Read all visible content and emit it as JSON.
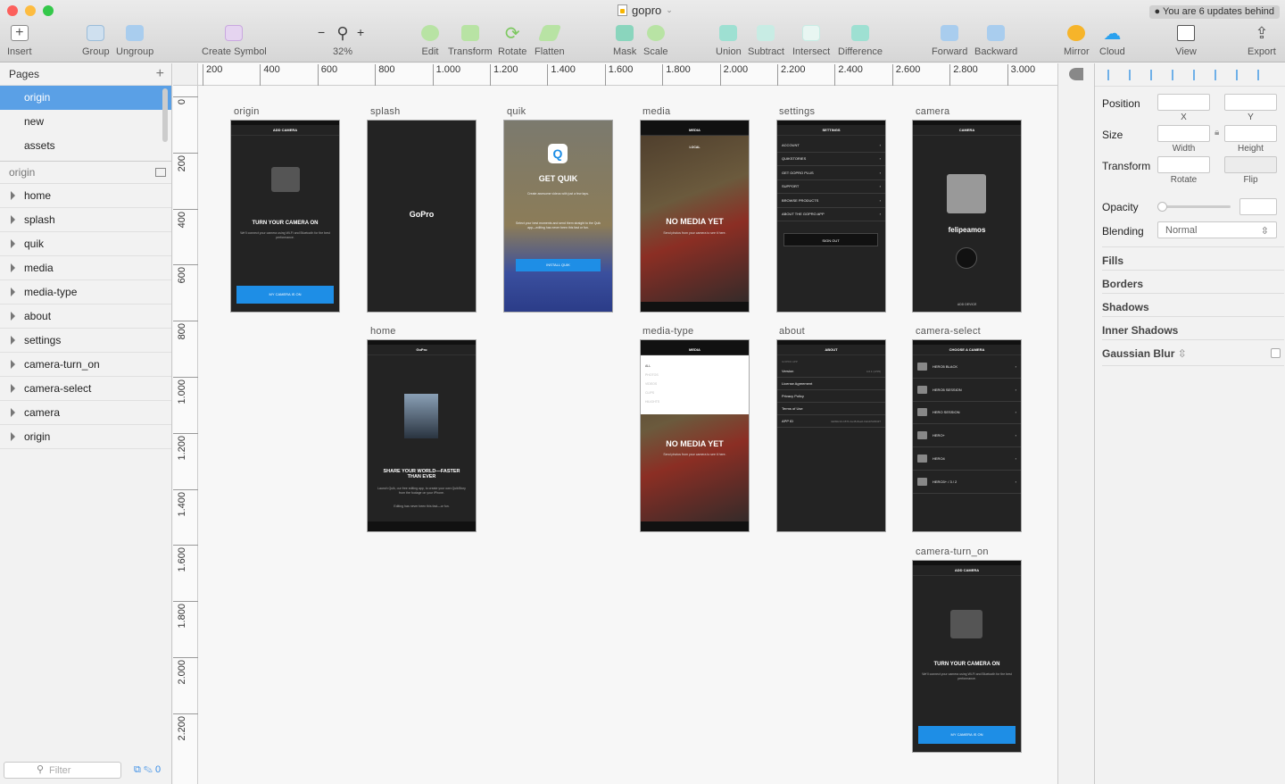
{
  "window": {
    "title": "gopro",
    "update_notice": "You are 6 updates behind"
  },
  "toolbar": {
    "insert": "Insert",
    "group": "Group",
    "ungroup": "Ungroup",
    "create_symbol": "Create Symbol",
    "zoom": "32%",
    "zoom_out": "−",
    "zoom_in": "+",
    "edit": "Edit",
    "transform": "Transform",
    "rotate": "Rotate",
    "flatten": "Flatten",
    "mask": "Mask",
    "scale": "Scale",
    "union": "Union",
    "subtract": "Subtract",
    "intersect": "Intersect",
    "difference": "Difference",
    "forward": "Forward",
    "backward": "Backward",
    "mirror": "Mirror",
    "cloud": "Cloud",
    "view": "View",
    "export": "Export"
  },
  "pages": {
    "header": "Pages",
    "add": "+",
    "items": [
      "origin",
      "new",
      "assets"
    ]
  },
  "layers": {
    "header": "origin",
    "items": [
      "home",
      "splash",
      "quik",
      "media",
      "media-type",
      "about",
      "settings",
      "camera-turn_on",
      "camera-select",
      "camera",
      "origin"
    ]
  },
  "filter": {
    "placeholder": "Filter",
    "count": "0"
  },
  "ruler": {
    "top": [
      "200",
      "400",
      "600",
      "800",
      "1.000",
      "1.200",
      "1.400",
      "1.600",
      "1.800",
      "2.000",
      "2.200",
      "2.400",
      "2.600",
      "2.800",
      "3.000"
    ],
    "left": [
      "0",
      "200",
      "400",
      "600",
      "800",
      "1.000",
      "1.200",
      "1.400",
      "1.600",
      "1.800",
      "2.000",
      "2.200"
    ]
  },
  "artboards": {
    "origin": {
      "label": "origin",
      "header": "ADD CAMERA",
      "title": "TURN YOUR CAMERA ON",
      "body": "We'll connect your camera using Wi-Fi and Bluetooth for the best performance.",
      "button": "MY CAMERA IS ON"
    },
    "splash": {
      "label": "splash",
      "logo": "GoPro"
    },
    "quik": {
      "label": "quik",
      "title": "GET QUIK",
      "body": "Create awesome videos with just a few taps.",
      "body2": "Select your best moments and send them straight to the Quik app—editing has never been this fast or fun.",
      "button": "INSTALL QUIK"
    },
    "media": {
      "label": "media",
      "header": "MEDIA",
      "tab": "LOCAL",
      "title": "NO MEDIA YET",
      "body": "Send photos from your camera to see it here."
    },
    "settings": {
      "label": "settings",
      "header": "SETTINGS",
      "rows": [
        "ACCOUNT",
        "QUIKSTORIES",
        "GET GOPRO PLUS",
        "SUPPORT",
        "BROWSE PRODUCTS",
        "ABOUT THE GOPRO APP"
      ],
      "button": "SIGN OUT"
    },
    "camera": {
      "label": "camera",
      "header": "CAMERA",
      "name": "felipeamos",
      "footer": "ADD DEVICE"
    },
    "home": {
      "label": "home",
      "logo": "GoPro",
      "title": "SHARE YOUR WORLD—FASTER THAN EVER",
      "body": "Launch Quik, our free editing app, to create your own QuikStory from the footage on your iPhone.",
      "body2": "Editing has never been this fast—or fun."
    },
    "media_type": {
      "label": "media-type",
      "header": "MEDIA",
      "options": [
        "ALL",
        "PHOTOS",
        "VIDEOS",
        "CLIPS",
        "HILIGHTS"
      ],
      "title": "NO MEDIA YET",
      "body": "Send photos from your camera to see it here."
    },
    "about": {
      "label": "about",
      "header": "ABOUT",
      "section": "GOPRO APP",
      "rows": [
        [
          "Version",
          "4.0.1 (1705)"
        ],
        [
          "License Agreement",
          ""
        ],
        [
          "Privacy Policy",
          ""
        ],
        [
          "Terms of Use",
          ""
        ],
        [
          "APP ID",
          "3a68dc10-b87b-4e48-8ae0-0dccb52364f7"
        ]
      ]
    },
    "camera_select": {
      "label": "camera-select",
      "header": "CHOOSE A CAMERA",
      "rows": [
        "HERO5 BLACK",
        "HERO5 SESSION",
        "HERO SESSION",
        "HERO+",
        "HERO4",
        "HERO3+ / 3 / 2"
      ]
    },
    "camera_turn_on": {
      "label": "camera-turn_on",
      "header": "ADD CAMERA",
      "title": "TURN YOUR CAMERA ON",
      "body": "We'll connect your camera using Wi-Fi and Bluetooth for the best performance.",
      "button": "MY CAMERA IS ON"
    }
  },
  "inspector": {
    "position": "Position",
    "x": "X",
    "y": "Y",
    "size": "Size",
    "width": "Width",
    "height": "Height",
    "transform": "Transform",
    "rotate": "Rotate",
    "flip": "Flip",
    "opacity": "Opacity",
    "blending": "Blending",
    "blending_value": "Normal",
    "fills": "Fills",
    "borders": "Borders",
    "shadows": "Shadows",
    "inner_shadows": "Inner Shadows",
    "gaussian_blur": "Gaussian Blur"
  },
  "colors": {
    "selection": "#5aa0e6",
    "accent_blue": "#1e8ee6",
    "artboard_bg": "#232323"
  }
}
